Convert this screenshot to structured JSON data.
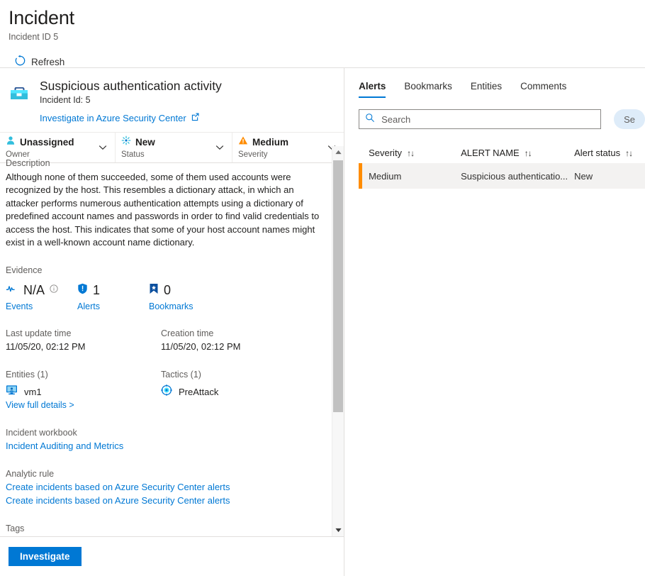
{
  "header": {
    "title": "Incident",
    "subtitle": "Incident ID 5",
    "refresh_label": "Refresh",
    "refresh_icon": "refresh-icon"
  },
  "incident": {
    "icon": "briefcase-icon",
    "name": "Suspicious authentication activity",
    "id_label": "Incident Id: 5",
    "external_link": "Investigate in Azure Security Center",
    "external_link_icon": "open-in-new-icon",
    "properties": [
      {
        "value": "Unassigned",
        "label": "Owner",
        "icon": "person-icon",
        "chevron": "chevron-down-icon"
      },
      {
        "value": "New",
        "label": "Status",
        "icon": "starburst-icon",
        "chevron": "chevron-down-icon"
      },
      {
        "value": "Medium",
        "label": "Severity",
        "icon": "warning-triangle-icon",
        "chevron": "chevron-down-icon"
      }
    ]
  },
  "details": {
    "description_label": "Description",
    "description_text": "Although none of them succeeded, some of them used accounts were recognized by the host. This resembles a dictionary attack, in which an attacker performs numerous authentication attempts using a dictionary of predefined account names and passwords in order to find valid credentials to access the host. This indicates that some of your host account names might exist in a well-known account name dictionary.",
    "evidence_label": "Evidence",
    "evidence": [
      {
        "count": "N/A",
        "name": "Events",
        "icon": "pulse-icon",
        "info_icon": "info-icon"
      },
      {
        "count": "1",
        "name": "Alerts",
        "icon": "shield-icon"
      },
      {
        "count": "0",
        "name": "Bookmarks",
        "icon": "bookmark-icon"
      }
    ],
    "last_update_label": "Last update time",
    "last_update_value": "11/05/20, 02:12 PM",
    "creation_label": "Creation time",
    "creation_value": "11/05/20, 02:12 PM",
    "entities_label": "Entities (1)",
    "entity_name": "vm1",
    "entity_icon": "host-computer-icon",
    "view_full_details": "View full details >",
    "tactics_label": "Tactics (1)",
    "tactic_name": "PreAttack",
    "tactic_icon": "target-icon",
    "workbook_label": "Incident workbook",
    "workbook_link": "Incident Auditing and Metrics",
    "analytic_rule_label": "Analytic rule",
    "analytic_rules": [
      "Create incidents based on Azure Security Center alerts",
      "Create incidents based on Azure Security Center alerts"
    ],
    "tags_label": "Tags"
  },
  "footer": {
    "investigate_label": "Investigate"
  },
  "right": {
    "tabs": [
      {
        "label": "Alerts",
        "active": true
      },
      {
        "label": "Bookmarks",
        "active": false
      },
      {
        "label": "Entities",
        "active": false
      },
      {
        "label": "Comments",
        "active": false
      }
    ],
    "search": {
      "placeholder": "Search",
      "value": "",
      "icon": "search-icon"
    },
    "search_button_label": "Se",
    "table": {
      "columns": [
        {
          "label": "Severity",
          "sort": "↑↓"
        },
        {
          "label": "ALERT NAME",
          "sort": "↑↓"
        },
        {
          "label": "Alert status",
          "sort": "↑↓"
        }
      ],
      "rows": [
        {
          "severity": "Medium",
          "alert_name": "Suspicious authenticatio...",
          "alert_status": "New",
          "severity_color": "#ff8c00"
        }
      ]
    }
  },
  "scrollbar": {
    "up_icon": "caret-up-icon",
    "down_icon": "caret-down-icon"
  },
  "colors": {
    "accent": "#0078d4",
    "severity_medium": "#ff8c00",
    "row_bg": "#f3f2f1"
  }
}
